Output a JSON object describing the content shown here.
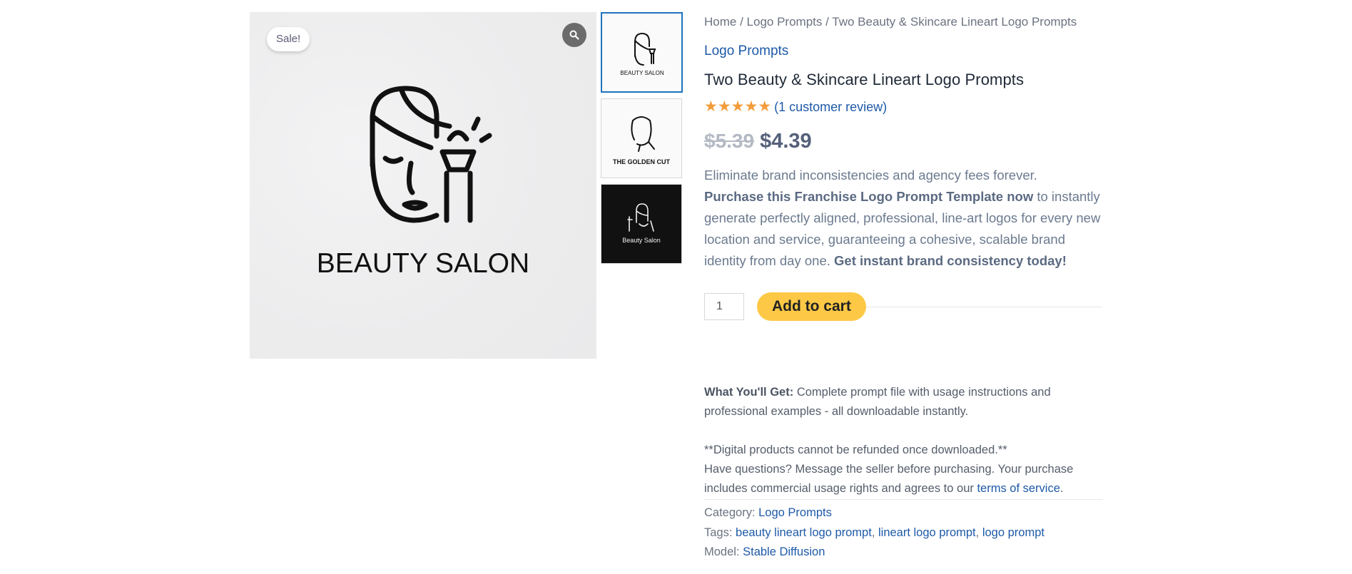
{
  "gallery": {
    "sale_badge": "Sale!",
    "main_image_text": "BEAUTY SALON",
    "zoom_icon": "search-icon",
    "thumbnails": [
      {
        "caption": "BEAUTY SALON"
      },
      {
        "caption": "THE GOLDEN CUT"
      },
      {
        "caption": "Beauty Salon"
      }
    ]
  },
  "breadcrumb": {
    "home": "Home",
    "sep1": " / ",
    "category": "Logo Prompts",
    "sep2": " / ",
    "current": "Two Beauty & Skincare Lineart Logo Prompts"
  },
  "product": {
    "category_link": "Logo Prompts",
    "title": "Two Beauty & Skincare Lineart Logo Prompts",
    "rating": 5,
    "review_link": "(1 customer review)",
    "old_price": "$5.39",
    "new_price": "$4.39",
    "description": {
      "p1": "Eliminate brand inconsistencies and agency fees forever.",
      "bold1": "Purchase this Franchise Logo Prompt Template now",
      "p2": " to instantly generate perfectly aligned, professional, line-art logos for every new location and service, guaranteeing a cohesive, scalable brand identity from day one. ",
      "bold2": "Get instant brand consistency today!"
    },
    "quantity": "1",
    "add_to_cart": "Add to cart"
  },
  "extra": {
    "what_label": "What You'll Get:",
    "what_text": " Complete prompt file with usage instructions and professional examples - all downloadable instantly.",
    "refund": "**Digital products cannot be refunded once downloaded.**",
    "questions": "Have questions? Message the seller before purchasing. Your purchase includes commercial usage rights and agrees to our ",
    "tos_link": "terms of service",
    "tos_end": "."
  },
  "meta": {
    "category_label": "Category: ",
    "category_value": "Logo Prompts",
    "tags_label": "Tags: ",
    "tags": [
      "beauty lineart logo prompt",
      "lineart logo prompt",
      "logo prompt"
    ],
    "tag_sep": ", ",
    "model_label": "Model: ",
    "model_value": "Stable Diffusion"
  },
  "colors": {
    "accent": "#1e5aa8",
    "cart_button": "#fdc845",
    "star": "#f39c3b"
  }
}
